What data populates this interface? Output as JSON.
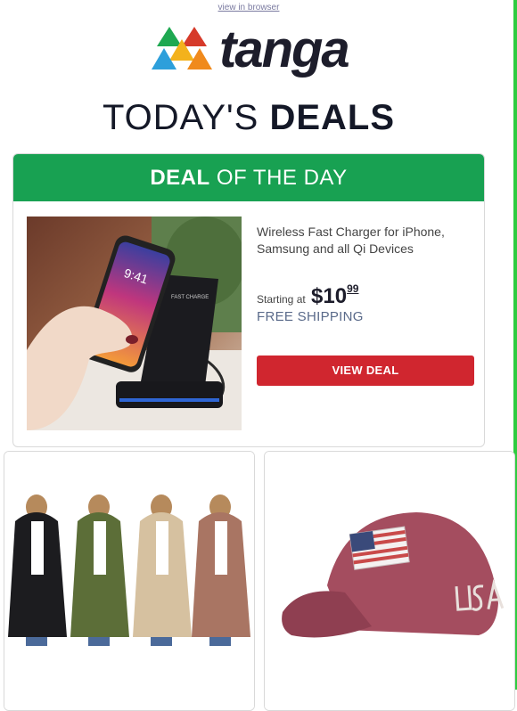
{
  "top_link": "view in browser",
  "brand": {
    "name": "tanga"
  },
  "headline": {
    "light": "TODAY'S ",
    "bold": "DEALS"
  },
  "deal_of_the_day": {
    "banner_bold": "DEAL",
    "banner_rest": " OF THE DAY",
    "product_title": "Wireless Fast Charger for iPhone, Samsung and all Qi Devices",
    "price_prefix": "Starting at",
    "price_dollars": "$10",
    "price_cents": "99",
    "shipping": "FREE SHIPPING",
    "cta": "VIEW DEAL"
  },
  "colors": {
    "accent_green": "#18a152",
    "cta_red": "#d0262f",
    "edge_green": "#2ecc40"
  },
  "more_deals": [
    {
      "image": "hooded-sherpa-cardigans-photo"
    },
    {
      "image": "usa-flag-baseball-cap-photo"
    }
  ]
}
